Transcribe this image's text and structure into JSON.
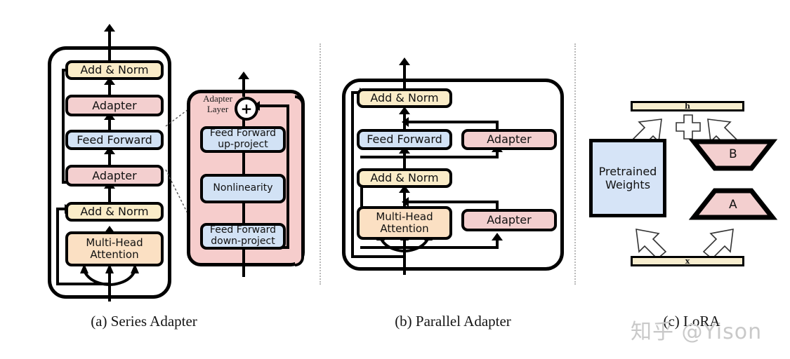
{
  "figure": {
    "panels": [
      {
        "id": "a",
        "caption": "(a) Series Adapter",
        "blocks": [
          {
            "label": "Add & Norm",
            "type": "addnorm"
          },
          {
            "label": "Adapter",
            "type": "adapter"
          },
          {
            "label": "Feed Forward",
            "type": "feedforward"
          },
          {
            "label": "Adapter",
            "type": "adapter"
          },
          {
            "label": "Add & Norm",
            "type": "addnorm"
          },
          {
            "label": "Multi-Head\nAttention",
            "type": "attention"
          }
        ],
        "detail": {
          "title_line1": "Adapter",
          "title_line2": "Layer",
          "plus_symbol": "+",
          "blocks": [
            {
              "label": "Feed Forward\nup-project",
              "type": "feedforward"
            },
            {
              "label": "Nonlinearity",
              "type": "feedforward"
            },
            {
              "label": "Feed Forward\ndown-project",
              "type": "feedforward"
            }
          ]
        }
      },
      {
        "id": "b",
        "caption": "(b) Parallel Adapter",
        "blocks": [
          {
            "label": "Add & Norm",
            "type": "addnorm"
          },
          {
            "label": "Feed Forward",
            "type": "feedforward"
          },
          {
            "label": "Adapter",
            "type": "adapter"
          },
          {
            "label": "Add & Norm",
            "type": "addnorm"
          },
          {
            "label": "Multi-Head\nAttention",
            "type": "attention"
          },
          {
            "label": "Adapter",
            "type": "adapter"
          }
        ]
      },
      {
        "id": "c",
        "caption": "(c) LoRA",
        "blocks": [
          {
            "label": "h",
            "type": "bar"
          },
          {
            "label": "Pretrained\nWeights",
            "type": "weights"
          },
          {
            "label": "B",
            "type": "trapezoid-down"
          },
          {
            "label": "A",
            "type": "trapezoid-up"
          },
          {
            "label": "x",
            "type": "bar"
          }
        ],
        "operator": "+"
      }
    ],
    "watermark": "知乎 @Yison",
    "colors": {
      "addnorm": "#faecc8",
      "adapter": "#f3cfcf",
      "feedforward": "#d2e2f5",
      "attention": "#fbe0c3",
      "adapter_panel": "#f6cdcc",
      "weights": "#d6e4f7",
      "bar": "#f7edce",
      "outline": "#000000",
      "divider": "#b9b9b9",
      "watermark": "#c9c9c9"
    },
    "labels": {
      "caption_a": "(a) Series Adapter",
      "caption_b": "(b) Parallel Adapter",
      "caption_c": "(c) LoRA",
      "adapter_layer_l1": "Adapter",
      "adapter_layer_l2": "Layer",
      "addnorm": "Add & Norm",
      "adapter": "Adapter",
      "feedforward": "Feed Forward",
      "attention_l1": "Multi-Head",
      "attention_l2": "Attention",
      "ff_up_l1": "Feed Forward",
      "ff_up_l2": "up-project",
      "nonlinearity": "Nonlinearity",
      "ff_down_l1": "Feed Forward",
      "ff_down_l2": "down-project",
      "h": "h",
      "x": "x",
      "pretrained_l1": "Pretrained",
      "pretrained_l2": "Weights",
      "B": "B",
      "A": "A",
      "plus": "+"
    }
  }
}
